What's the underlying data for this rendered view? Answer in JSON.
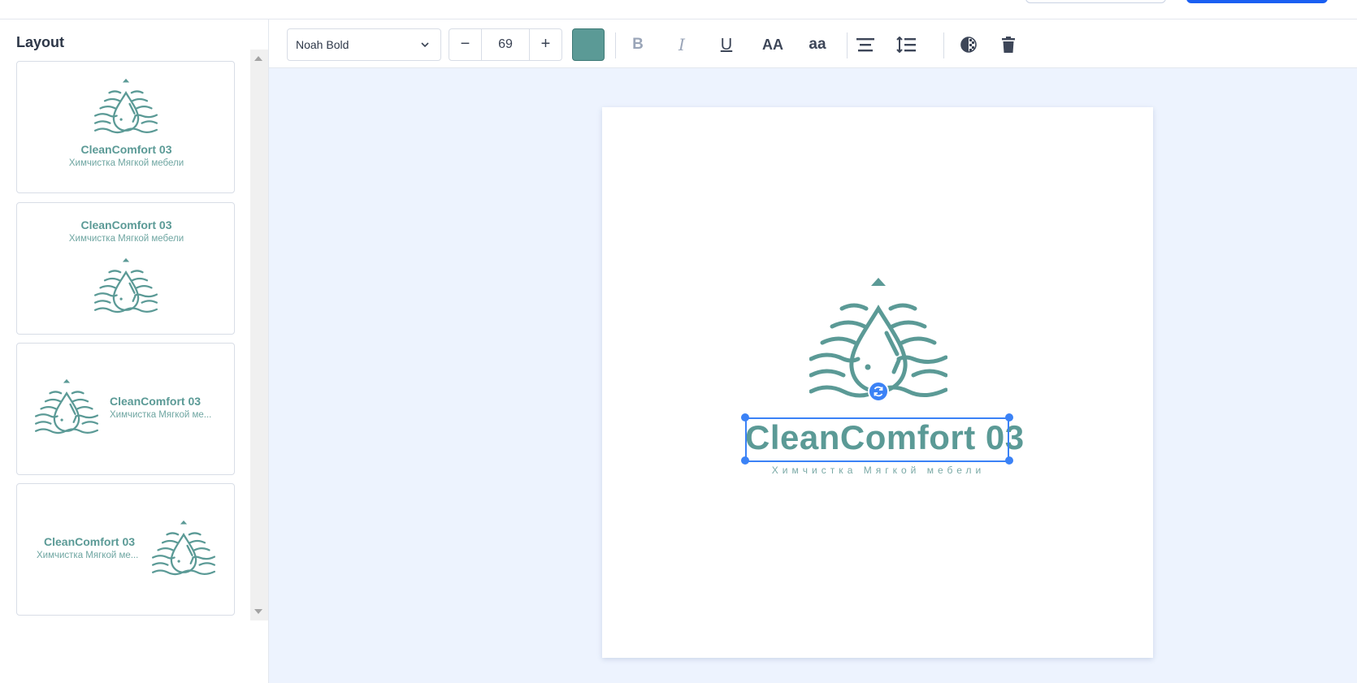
{
  "sidebar": {
    "title": "Layout",
    "layouts": [
      {
        "name": "CleanComfort 03",
        "subtitle": "Химчистка Мягкой мебели"
      },
      {
        "name": "CleanComfort 03",
        "subtitle": "Химчистка Мягкой мебели"
      },
      {
        "name": "CleanComfort 03",
        "subtitle": "Химчистка Мягкой ме..."
      },
      {
        "name": "CleanComfort 03",
        "subtitle": "Химчистка Мягкой ме..."
      }
    ]
  },
  "toolbar": {
    "font": "Noah Bold",
    "minus": "−",
    "size": "69",
    "plus": "+",
    "color": "#5b9a96",
    "bold": "B",
    "italic": "I",
    "underline": "U",
    "uppercase": "AA",
    "lowercase": "aa"
  },
  "canvas": {
    "logo_name": "CleanComfort 03",
    "logo_subtitle": "Химчистка Мягкой мебели"
  },
  "icons": [
    "chevron-down-icon",
    "align-center-icon",
    "line-spacing-icon",
    "opacity-icon",
    "trash-icon",
    "rotate-icon",
    "water-drop-logo"
  ]
}
